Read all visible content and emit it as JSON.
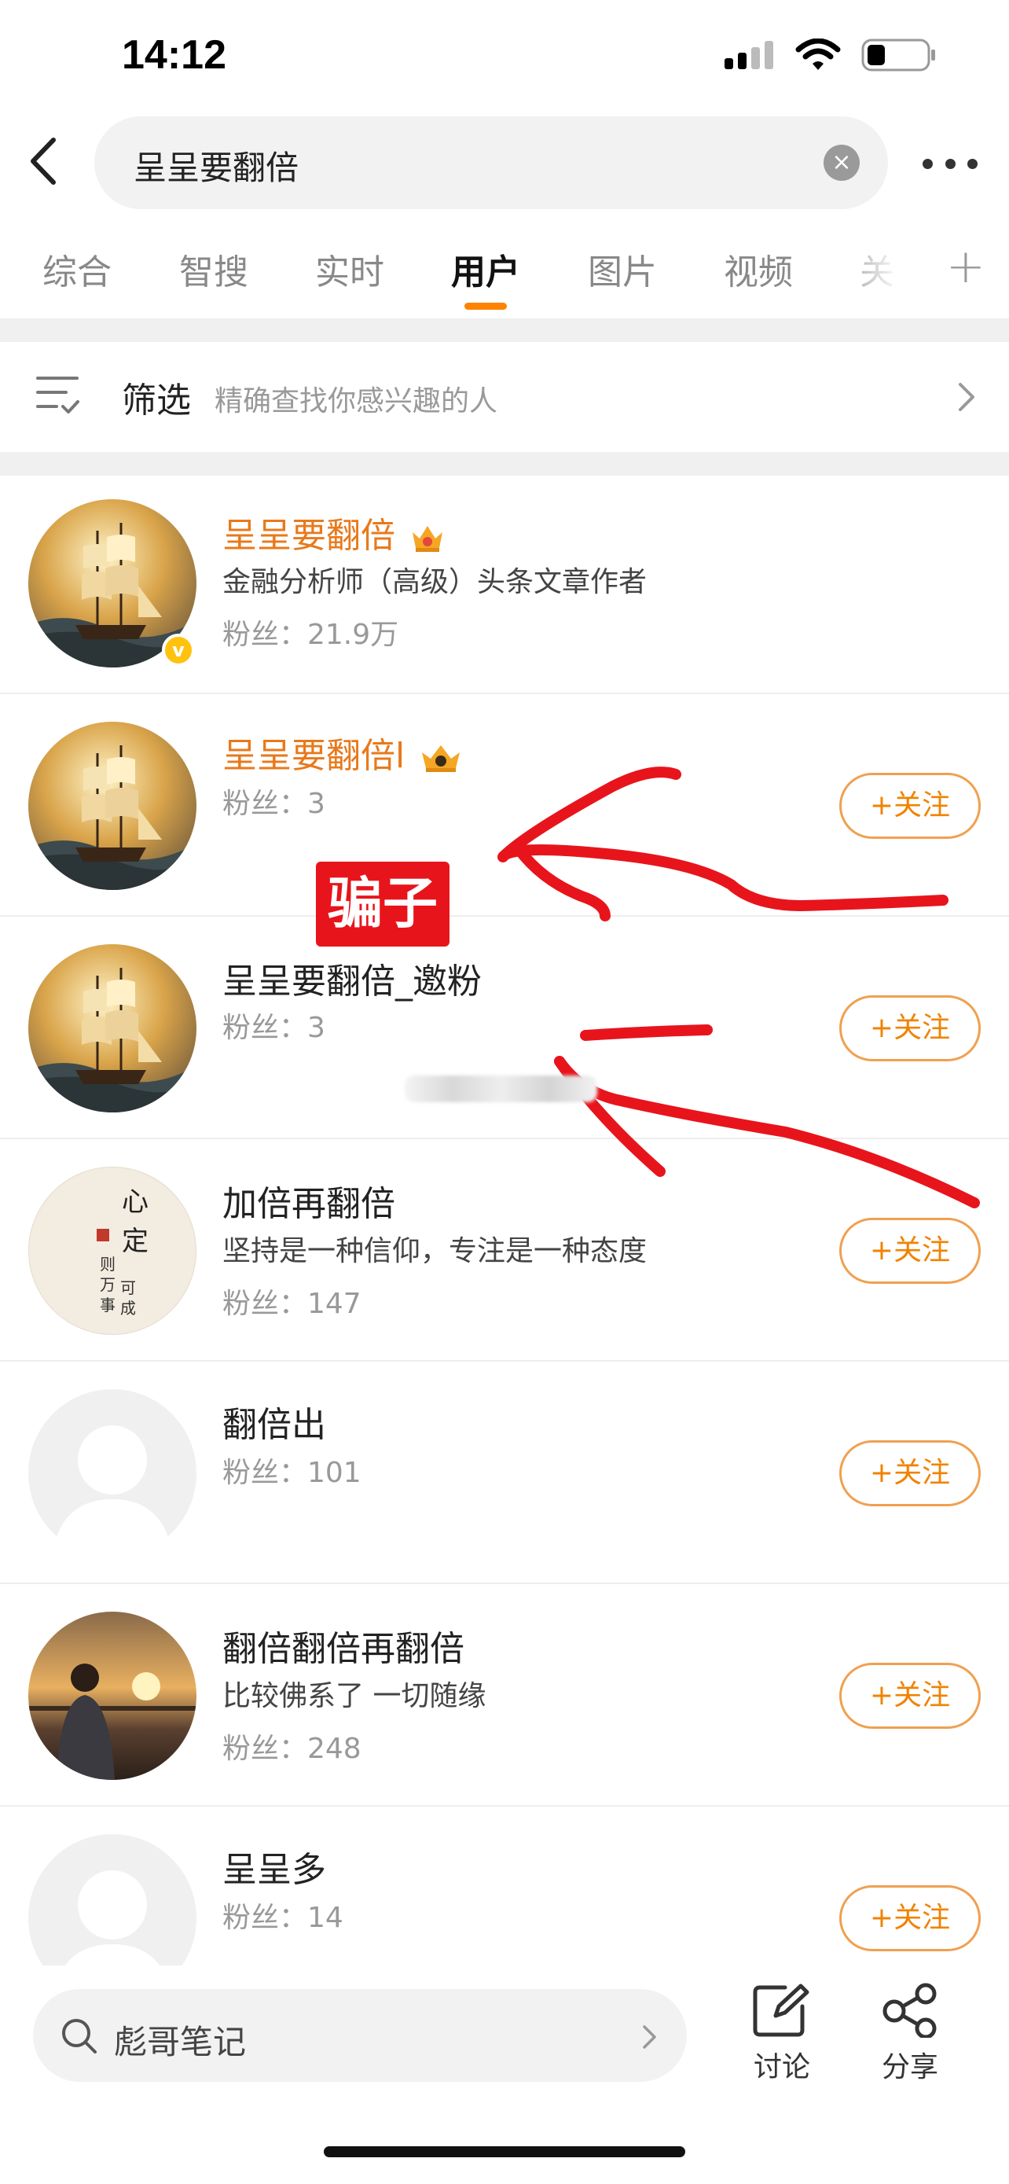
{
  "status_bar": {
    "time": "14:12"
  },
  "search": {
    "query": "呈呈要翻倍"
  },
  "tabs": [
    {
      "label": "综合"
    },
    {
      "label": "智搜"
    },
    {
      "label": "实时"
    },
    {
      "label": "用户"
    },
    {
      "label": "图片"
    },
    {
      "label": "视频"
    },
    {
      "label": "关"
    }
  ],
  "filter": {
    "label": "筛选",
    "hint": "精确查找你感兴趣的人"
  },
  "follow_label": "+关注",
  "results": [
    {
      "name": "呈呈要翻倍",
      "desc": "金融分析师（高级）头条文章作者",
      "fans": "粉丝：21.9万",
      "vip": true,
      "verified": true,
      "followable": false
    },
    {
      "name": "呈呈要翻倍l",
      "fans": "粉丝：3",
      "vip": true,
      "verified": false,
      "followable": true
    },
    {
      "name": "呈呈要翻倍_邀粉",
      "fans": "粉丝：3",
      "vip": false,
      "followable": true
    },
    {
      "name": "加倍再翻倍",
      "desc": "坚持是一种信仰，专注是一种态度",
      "fans": "粉丝：147",
      "followable": true
    },
    {
      "name": "翻倍出",
      "fans": "粉丝：101",
      "followable": true
    },
    {
      "name": "翻倍翻倍再翻倍",
      "desc": "比较佛系了 一切随缘",
      "fans": "粉丝：248",
      "followable": true
    },
    {
      "name": "呈呈多",
      "fans": "粉丝：14",
      "followable": true
    }
  ],
  "annotation": {
    "label": "骗子",
    "color": "#e8141c"
  },
  "avatar_art": {
    "ink_chars": [
      "心",
      "定",
      "则",
      "万",
      "事",
      "可",
      "成"
    ]
  },
  "bottom_bar": {
    "search_text": "彪哥笔记",
    "discuss_label": "讨论",
    "share_label": "分享"
  },
  "colors": {
    "accent": "#ff8200",
    "vip_name": "#e8791b",
    "follow": "#f08300"
  }
}
